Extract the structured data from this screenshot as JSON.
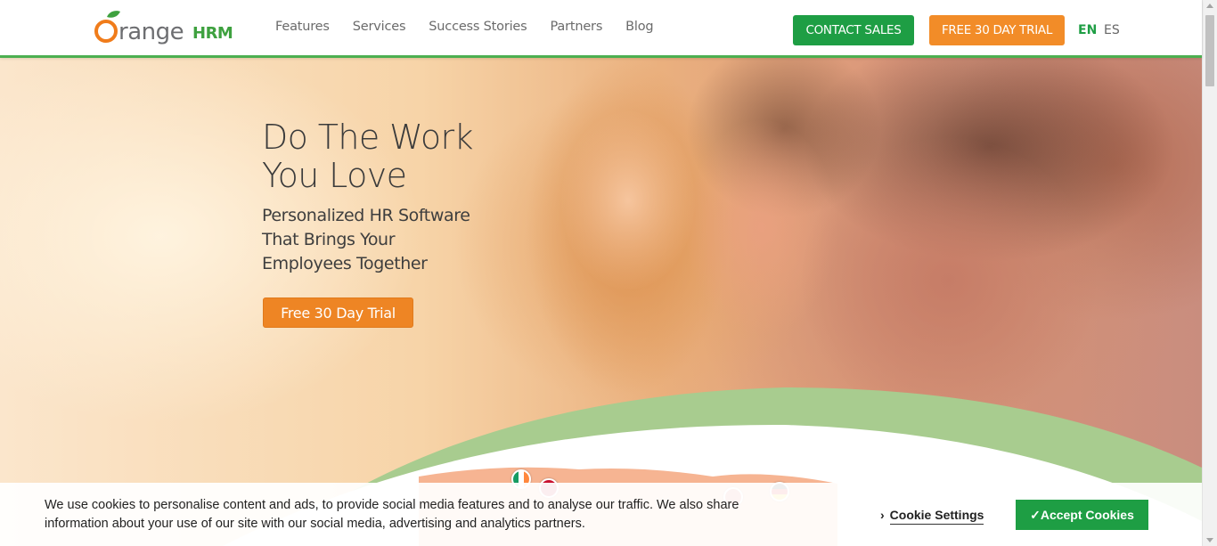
{
  "header": {
    "logo_main": "range",
    "logo_o": "O",
    "logo_suffix": "HRM",
    "nav": [
      "Features",
      "Services",
      "Success Stories",
      "Partners",
      "Blog"
    ],
    "contact_sales": "CONTACT SALES",
    "free_trial": "FREE 30 DAY TRIAL",
    "lang_en": "EN",
    "lang_es": "ES"
  },
  "hero": {
    "title_line1": "Do The Work",
    "title_line2": "You Love",
    "sub_line1": "Personalized HR Software",
    "sub_line2": "That Brings Your",
    "sub_line3": "Employees Together",
    "cta": "Free 30 Day Trial"
  },
  "cookie": {
    "text": "We use cookies to personalise content and ads, to provide social media features and to analyse our traffic. We also share information about your use of our site with our social media, advertising and analytics partners.",
    "settings": "Cookie Settings",
    "accept": "✓Accept Cookies"
  },
  "colors": {
    "brand_green": "#1e9e44",
    "brand_orange": "#f28c28",
    "curve_green": "#a8cc8f"
  }
}
